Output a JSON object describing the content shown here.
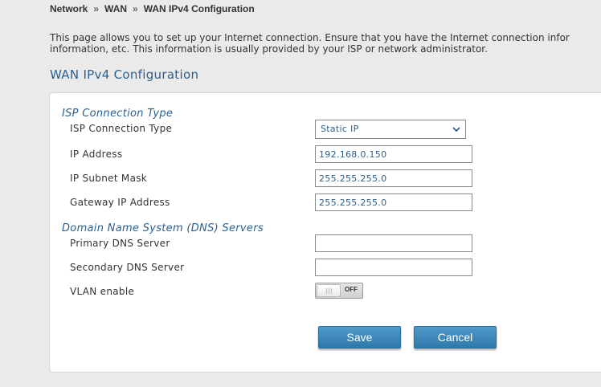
{
  "breadcrumb": {
    "items": [
      "Network",
      "WAN",
      "WAN IPv4 Configuration"
    ],
    "separator": "»"
  },
  "intro": {
    "line1": "This page allows you to set up your Internet connection. Ensure that you have the Internet connection infor",
    "line2": "information, etc. This information is usually provided by your ISP or network administrator."
  },
  "page_title": "WAN IPv4 Configuration",
  "isp_section": {
    "title": "ISP Connection Type",
    "connection_type_label": "ISP Connection Type",
    "connection_type_value": "Static IP",
    "ip_address_label": "IP Address",
    "ip_address_value": "192.168.0.150",
    "subnet_mask_label": "IP Subnet Mask",
    "subnet_mask_value": "255.255.255.0",
    "gateway_label": "Gateway IP Address",
    "gateway_value": "255.255.255.0"
  },
  "dns_section": {
    "title": "Domain Name System (DNS) Servers",
    "primary_label": "Primary DNS Server",
    "primary_value": "",
    "secondary_label": "Secondary DNS Server",
    "secondary_value": ""
  },
  "vlan": {
    "label": "VLAN enable",
    "state_text": "OFF"
  },
  "actions": {
    "save_label": "Save",
    "cancel_label": "Cancel"
  },
  "colors": {
    "accent_blue": "#2a5f8f",
    "button_blue": "#3a85b9",
    "background": "#eaeaea"
  }
}
